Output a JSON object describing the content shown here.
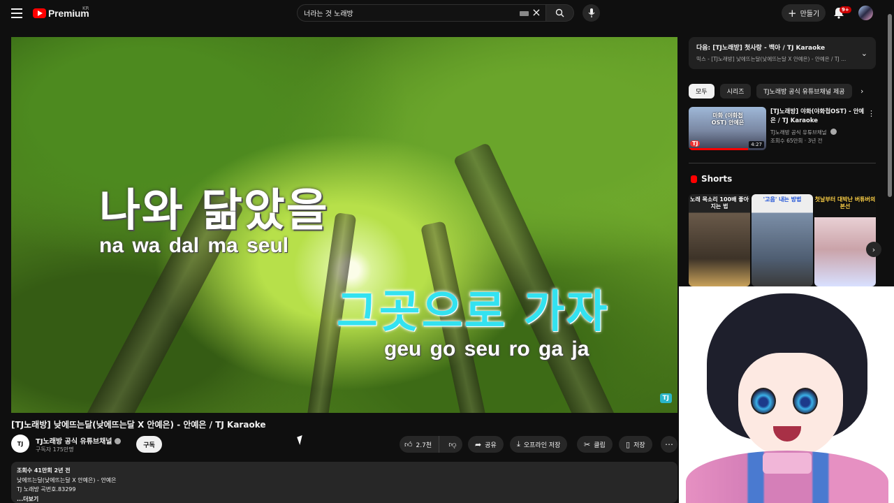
{
  "header": {
    "logo_text": "Premium",
    "logo_region": "KR",
    "search_value": "너라는 것 노래방",
    "create_label": "만들기",
    "notification_count": "9+"
  },
  "video": {
    "lyric_line1": "나와 닮았을",
    "roman_line1": "na wa  dal ma seul",
    "lyric_line2": "그곳으로 가자",
    "roman_line2": "geu go seu ro  ga ja",
    "watermark": "TJ",
    "title": "[TJ노래방] 낮에뜨는달(낮에뜨는달 X 안예은) - 안예은 / TJ Karaoke",
    "channel_avatar_text": "TJ",
    "channel_name": "TJ노래방 공식 유튜브채널",
    "subscribers": "구독자 175만명",
    "subscribe_label": "구독",
    "like_count": "2.7천",
    "share_label": "공유",
    "offline_label": "오프라인 저장",
    "clip_label": "클립",
    "save_label": "저장"
  },
  "description": {
    "views_date": "조회수 41만회  2년 전",
    "line1": "낮에뜨는달(낮에뜨는달 X 안예은) - 안예은",
    "line2": "TJ 노래방 곡번호.83299",
    "more": "...더보기"
  },
  "next_up": {
    "title": "다음: [TJ노래방] 첫사랑 - 백아 / TJ Karaoke",
    "subtitle": "믹스 - [TJ노래방] 낮에뜨는달(낮에뜨는달 X 안예은) - 안예은 / TJ ..."
  },
  "chips": [
    "모두",
    "시리즈",
    "TJ노래방 공식 유튜브채널 제공"
  ],
  "recommendation": {
    "thumb_text": "마화 (야화첩 OST) 안예은",
    "thumb_badge": "TJ",
    "duration": "4:27",
    "title": "[TJ노래방] 야화(야화첩OST) - 안예은 / TJ Karaoke",
    "channel": "TJ노래방 공식 유튜브채널",
    "meta": "조회수 65만회 · 3년 전"
  },
  "shorts": {
    "heading": "Shorts",
    "items": [
      "노래 목소리 100배 좋아지는 법",
      "'고음' 내는 방법",
      "첫날부터 대박난 버튜버의 본선"
    ]
  }
}
